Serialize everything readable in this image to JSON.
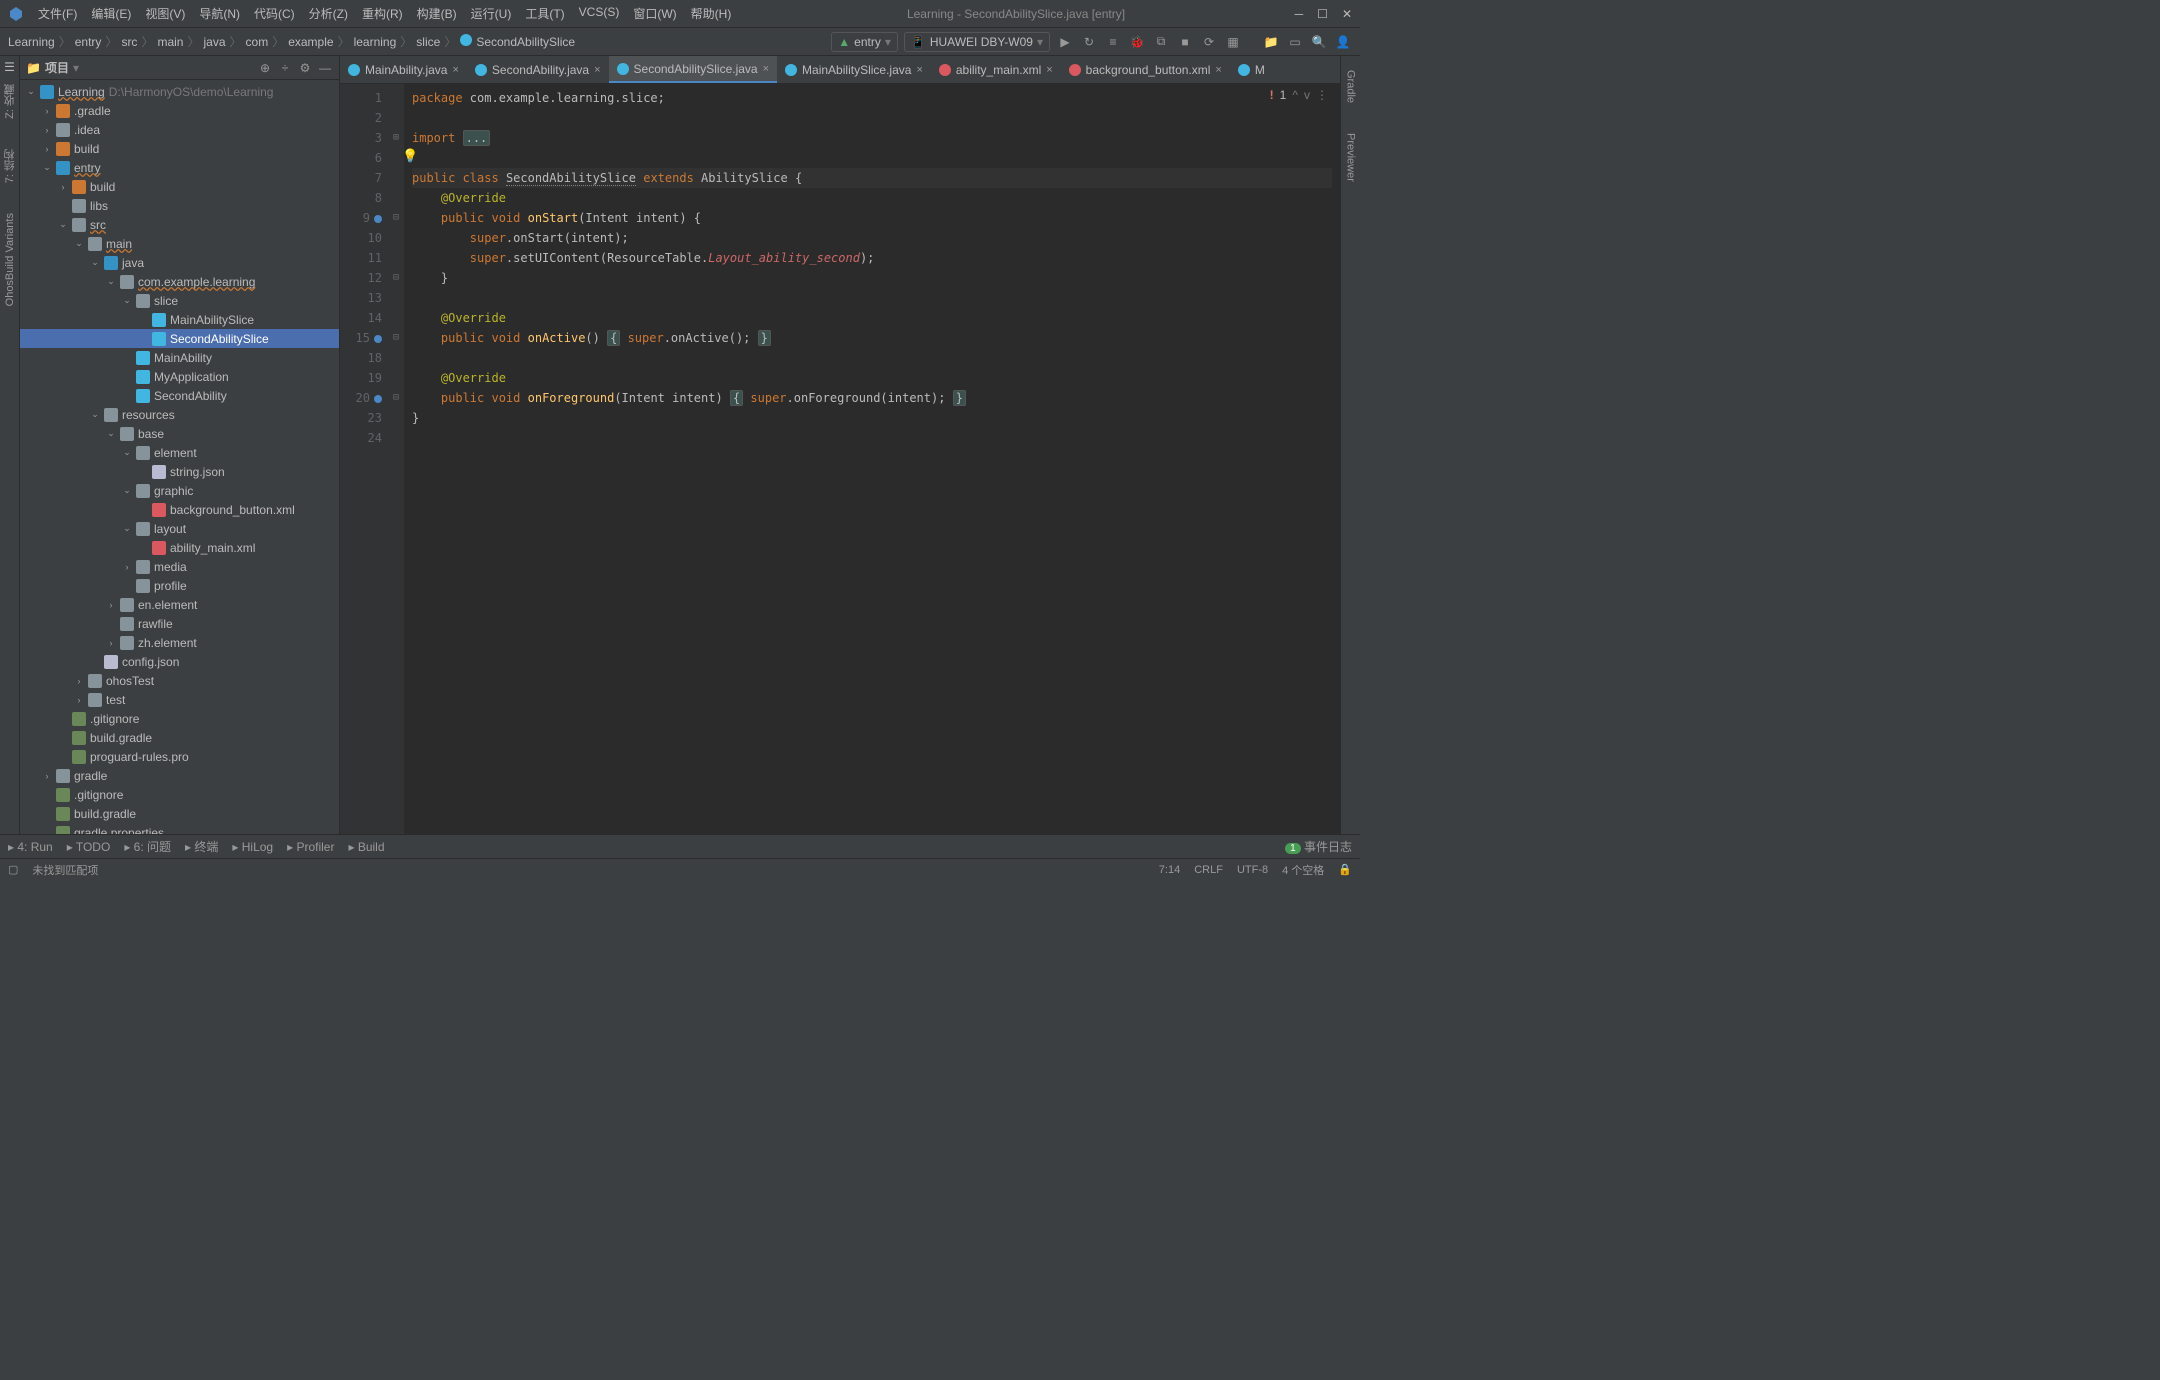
{
  "window": {
    "title": "Learning - SecondAbilitySlice.java [entry]"
  },
  "menus": [
    "文件(F)",
    "编辑(E)",
    "视图(V)",
    "导航(N)",
    "代码(C)",
    "分析(Z)",
    "重构(R)",
    "构建(B)",
    "运行(U)",
    "工具(T)",
    "VCS(S)",
    "窗口(W)",
    "帮助(H)"
  ],
  "breadcrumb": [
    "Learning",
    "entry",
    "src",
    "main",
    "java",
    "com",
    "example",
    "learning",
    "slice",
    "SecondAbilitySlice"
  ],
  "run_config": {
    "module": "entry",
    "device": "HUAWEI DBY-W09"
  },
  "sidebar": {
    "label": "项目",
    "tree": [
      {
        "d": 0,
        "a": "v",
        "i": "folder-ic-b",
        "t": "Learning",
        "suf": "D:\\HarmonyOS\\demo\\Learning",
        "wavy": true
      },
      {
        "d": 1,
        "a": ">",
        "i": "folder-ic-o",
        "t": ".gradle"
      },
      {
        "d": 1,
        "a": ">",
        "i": "folder-ic",
        "t": ".idea"
      },
      {
        "d": 1,
        "a": ">",
        "i": "folder-ic-o",
        "t": "build"
      },
      {
        "d": 1,
        "a": "v",
        "i": "folder-ic-b",
        "t": "entry",
        "wavy": true
      },
      {
        "d": 2,
        "a": ">",
        "i": "folder-ic-o",
        "t": "build"
      },
      {
        "d": 2,
        "a": "",
        "i": "folder-ic",
        "t": "libs"
      },
      {
        "d": 2,
        "a": "v",
        "i": "folder-ic",
        "t": "src",
        "wavy": true
      },
      {
        "d": 3,
        "a": "v",
        "i": "folder-ic",
        "t": "main",
        "wavy": true
      },
      {
        "d": 4,
        "a": "v",
        "i": "folder-ic-b",
        "t": "java"
      },
      {
        "d": 5,
        "a": "v",
        "i": "folder-ic",
        "t": "com.example.learning",
        "wavy": true
      },
      {
        "d": 6,
        "a": "v",
        "i": "folder-ic",
        "t": "slice"
      },
      {
        "d": 7,
        "a": "",
        "i": "file-ic-c",
        "t": "MainAbilitySlice"
      },
      {
        "d": 7,
        "a": "",
        "i": "file-ic-c",
        "t": "SecondAbilitySlice",
        "sel": true
      },
      {
        "d": 6,
        "a": "",
        "i": "file-ic-c",
        "t": "MainAbility"
      },
      {
        "d": 6,
        "a": "",
        "i": "file-ic-c",
        "t": "MyApplication"
      },
      {
        "d": 6,
        "a": "",
        "i": "file-ic-c",
        "t": "SecondAbility"
      },
      {
        "d": 4,
        "a": "v",
        "i": "folder-ic",
        "t": "resources"
      },
      {
        "d": 5,
        "a": "v",
        "i": "folder-ic",
        "t": "base"
      },
      {
        "d": 6,
        "a": "v",
        "i": "folder-ic",
        "t": "element"
      },
      {
        "d": 7,
        "a": "",
        "i": "file-ic-j",
        "t": "string.json"
      },
      {
        "d": 6,
        "a": "v",
        "i": "folder-ic",
        "t": "graphic"
      },
      {
        "d": 7,
        "a": "",
        "i": "file-ic-x",
        "t": "background_button.xml"
      },
      {
        "d": 6,
        "a": "v",
        "i": "folder-ic",
        "t": "layout"
      },
      {
        "d": 7,
        "a": "",
        "i": "file-ic-x",
        "t": "ability_main.xml"
      },
      {
        "d": 6,
        "a": ">",
        "i": "folder-ic",
        "t": "media"
      },
      {
        "d": 6,
        "a": "",
        "i": "folder-ic",
        "t": "profile"
      },
      {
        "d": 5,
        "a": ">",
        "i": "folder-ic",
        "t": "en.element"
      },
      {
        "d": 5,
        "a": "",
        "i": "folder-ic",
        "t": "rawfile"
      },
      {
        "d": 5,
        "a": ">",
        "i": "folder-ic",
        "t": "zh.element"
      },
      {
        "d": 4,
        "a": "",
        "i": "file-ic-j",
        "t": "config.json"
      },
      {
        "d": 3,
        "a": ">",
        "i": "folder-ic",
        "t": "ohosTest"
      },
      {
        "d": 3,
        "a": ">",
        "i": "folder-ic",
        "t": "test"
      },
      {
        "d": 2,
        "a": "",
        "i": "file-ic-g",
        "t": ".gitignore"
      },
      {
        "d": 2,
        "a": "",
        "i": "file-ic-g",
        "t": "build.gradle"
      },
      {
        "d": 2,
        "a": "",
        "i": "file-ic-g",
        "t": "proguard-rules.pro"
      },
      {
        "d": 1,
        "a": ">",
        "i": "folder-ic",
        "t": "gradle"
      },
      {
        "d": 1,
        "a": "",
        "i": "file-ic-g",
        "t": ".gitignore"
      },
      {
        "d": 1,
        "a": "",
        "i": "file-ic-g",
        "t": "build.gradle"
      },
      {
        "d": 1,
        "a": "",
        "i": "file-ic-g",
        "t": "gradle.properties"
      }
    ]
  },
  "tabs": [
    {
      "name": "MainAbility.java",
      "ic": "file-ic-c"
    },
    {
      "name": "SecondAbility.java",
      "ic": "file-ic-c"
    },
    {
      "name": "SecondAbilitySlice.java",
      "ic": "file-ic-c",
      "active": true
    },
    {
      "name": "MainAbilitySlice.java",
      "ic": "file-ic-c"
    },
    {
      "name": "ability_main.xml",
      "ic": "file-ic-x"
    },
    {
      "name": "background_button.xml",
      "ic": "file-ic-x"
    },
    {
      "name": "M",
      "ic": "file-ic-c",
      "trunc": true
    }
  ],
  "editor": {
    "error_count": "1",
    "lines": [
      {
        "n": 1,
        "html": "<span class='kw'>package</span> com.example.learning.slice;"
      },
      {
        "n": 2,
        "html": ""
      },
      {
        "n": 3,
        "fold": "+",
        "html": "<span class='kw'>import</span> <span class='fold-box'>...</span>"
      },
      {
        "n": 6,
        "html": ""
      },
      {
        "n": 7,
        "cur": true,
        "html": "<span class='kw'>public class</span> <span class='cls-wavy'>SecondAbilitySlice</span> <span class='kw'>extends</span> AbilitySlice {"
      },
      {
        "n": 8,
        "html": "    <span class='ann'>@Override</span>"
      },
      {
        "n": 9,
        "mark": true,
        "fold": "-",
        "html": "    <span class='kw'>public void</span> <span class='fn'>onStart</span>(Intent intent) {"
      },
      {
        "n": 10,
        "html": "        <span class='kw'>super</span>.onStart(intent);"
      },
      {
        "n": 11,
        "html": "        <span class='kw'>super</span>.setUIContent(ResourceTable.<span class='cst'>Layout_ability_second</span>);"
      },
      {
        "n": 12,
        "fold": "-",
        "html": "    }"
      },
      {
        "n": 13,
        "html": ""
      },
      {
        "n": 14,
        "html": "    <span class='ann'>@Override</span>"
      },
      {
        "n": 15,
        "mark": true,
        "fold": "-",
        "html": "    <span class='kw'>public void</span> <span class='fn'>onActive</span>() <span class='fold-box'>{</span> <span class='kw'>super</span>.onActive(); <span class='fold-box'>}</span>"
      },
      {
        "n": 18,
        "html": ""
      },
      {
        "n": 19,
        "html": "    <span class='ann'>@Override</span>"
      },
      {
        "n": 20,
        "mark": true,
        "fold": "-",
        "html": "    <span class='kw'>public void</span> <span class='fn'>onForeground</span>(Intent intent) <span class='fold-box'>{</span> <span class='kw'>super</span>.onForeground(intent); <span class='fold-box'>}</span>"
      },
      {
        "n": 23,
        "html": "}"
      },
      {
        "n": 24,
        "html": ""
      }
    ]
  },
  "bottom_tools": [
    "4: Run",
    "TODO",
    "6: 问题",
    "终端",
    "HiLog",
    "Profiler",
    "Build"
  ],
  "status": {
    "msg": "未找到匹配项",
    "pos": "7:14",
    "eol": "CRLF",
    "enc": "UTF-8",
    "indent": "4 个空格",
    "event": "事件日志",
    "event_badge": "1"
  },
  "left_tools": [
    "Z: 收藏",
    "7: 结构",
    "OhosBuild Variants"
  ],
  "right_tools": [
    "Gradle",
    "Previewer"
  ]
}
